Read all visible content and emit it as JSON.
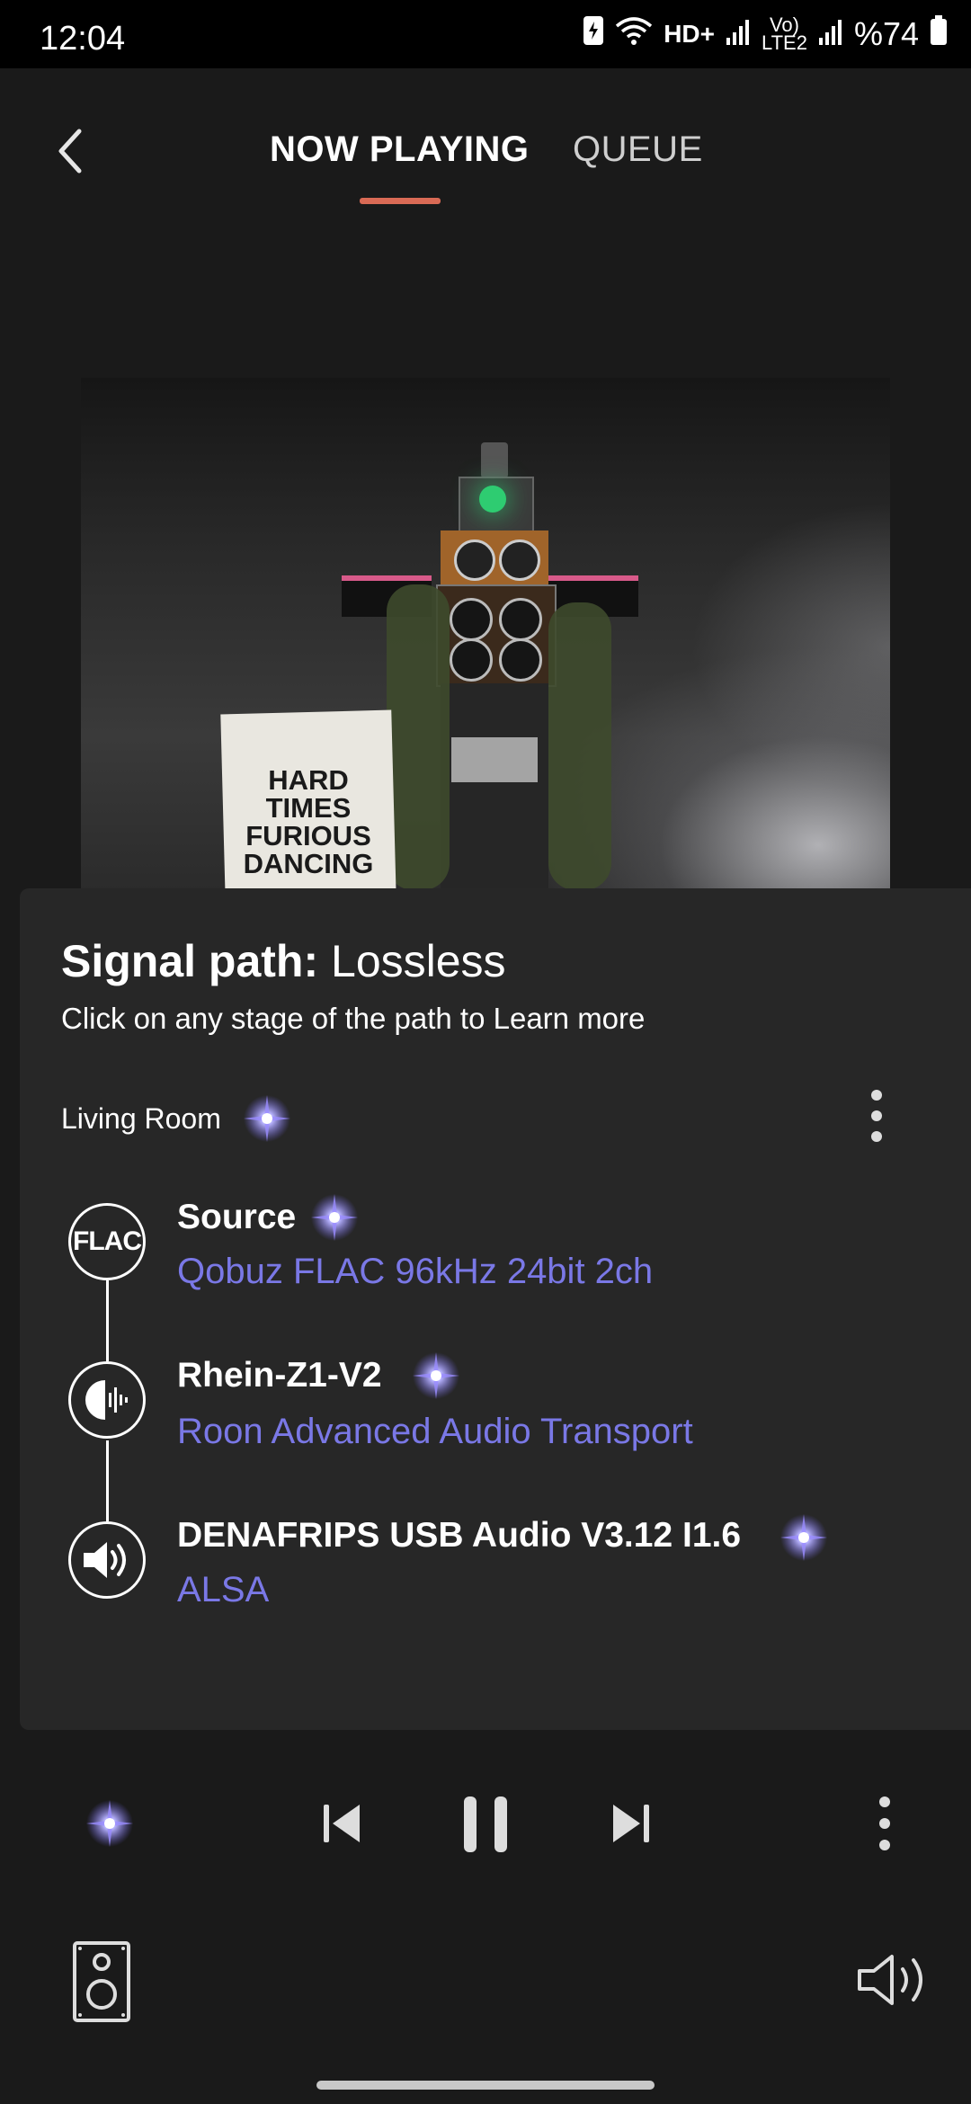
{
  "status_bar": {
    "time": "12:04",
    "network": "HD+",
    "lte": "VoLTE2",
    "battery_text": "%74"
  },
  "header": {
    "tabs": [
      {
        "label": "NOW PLAYING",
        "active": true
      },
      {
        "label": "QUEUE",
        "active": false
      }
    ],
    "accent_color": "#d96a55"
  },
  "album_art": {
    "flag_text": [
      "HARD",
      "TIMES",
      "FURIOUS",
      "DANCING"
    ]
  },
  "signal_path": {
    "title_prefix": "Signal path:",
    "quality": "Lossless",
    "subtitle": "Click on any stage of the path to Learn more",
    "zone": "Living Room",
    "stages": [
      {
        "icon": "flac-icon",
        "icon_text": "FLAC",
        "title": "Source",
        "detail": "Qobuz FLAC 96kHz 24bit 2ch"
      },
      {
        "icon": "roon-icon",
        "title": "Rhein-Z1-V2",
        "detail": "Roon Advanced Audio Transport"
      },
      {
        "icon": "speaker-icon",
        "title": "DENAFRIPS USB Audio V3.12 I1.6",
        "detail": "ALSA"
      }
    ],
    "quality_color": "#7a78e6",
    "detail_color": "#7a78e6"
  },
  "transport": {
    "icons": [
      "sparkle-icon",
      "previous-icon",
      "pause-icon",
      "next-icon",
      "more-vertical-icon",
      "speaker-device-icon",
      "volume-icon"
    ]
  }
}
